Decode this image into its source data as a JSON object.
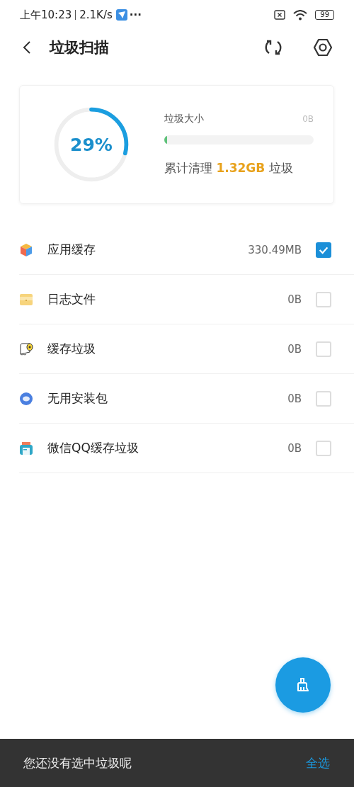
{
  "status_bar": {
    "time": "上午10:23",
    "speed": "2.1K/s",
    "more": "···",
    "battery": "99"
  },
  "header": {
    "title": "垃圾扫描"
  },
  "summary": {
    "percent": "29%",
    "level": 0.29,
    "size_label": "垃圾大小",
    "size_value": "0B",
    "bar": {
      "level": 0.02
    },
    "total_prefix": "累计清理",
    "total_amount": "1.32GB",
    "total_suffix": "垃圾"
  },
  "items": [
    {
      "kind": "app",
      "label": "应用缓存",
      "size": "330.49MB",
      "checked": true
    },
    {
      "kind": "log",
      "label": "日志文件",
      "size": "0B",
      "checked": false
    },
    {
      "kind": "cache",
      "label": "缓存垃圾",
      "size": "0B",
      "checked": false
    },
    {
      "kind": "package",
      "label": "无用安装包",
      "size": "0B",
      "checked": false
    },
    {
      "kind": "chat",
      "label": "微信QQ缓存垃圾",
      "size": "0B",
      "checked": false
    }
  ],
  "footer": {
    "message": "您还没有选中垃圾呢",
    "select_all": "全选"
  }
}
